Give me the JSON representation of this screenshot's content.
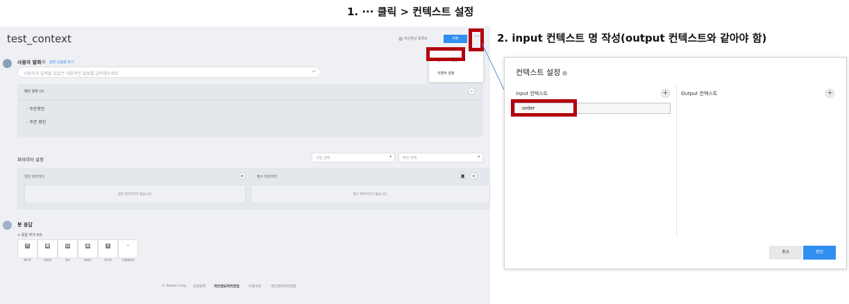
{
  "annotations": {
    "step1": "1. ··· 클릭 > 컨텍스트 설정",
    "step2": "2. input 컨텍스트 명 작성(output 컨텍스트와 같아야 함)"
  },
  "app": {
    "title": "test_context",
    "help_text": "하산하님 합류도",
    "save_label": "저장",
    "more_label": "···",
    "menu": [
      "컨텍스트 설정",
      "이벤트 설정"
    ],
    "user_speech": {
      "label": "사용자 발화",
      "link": "관련 도움말 보기",
      "placeholder": "사용자가 입력할 것같은 대표적인 발화를 입력해주세요",
      "list_title": "패턴 발화 (2)",
      "items": [
        "주문확인",
        "주문 확인"
      ]
    },
    "params": {
      "label": "파라미터 설정",
      "select1": "스킬 선택",
      "select2": "버전 선택",
      "general_title": "일반 파라미터",
      "general_empty": "일반 파라미터가 없습니다.",
      "required_title": "필수 파라미터",
      "required_empty": "필수 파라미터가 없습니다."
    },
    "bot": {
      "label": "봇 응답",
      "add_label": "+ 응답 추가 0/3",
      "tiles": [
        {
          "icon": "A",
          "label": "텍스트"
        },
        {
          "icon": "▣",
          "label": "이미지"
        },
        {
          "icon": "▤",
          "label": "카드"
        },
        {
          "icon": "▦",
          "label": "커머스"
        },
        {
          "icon": "≡",
          "label": "리스트"
        },
        {
          "icon": "‹›",
          "label": "스킬데이터"
        }
      ]
    },
    "footer": [
      "© Kakao Corp.",
      "운영정책",
      "개인정보처리방침",
      "이용약관",
      "개인정보처리방침"
    ]
  },
  "dialog": {
    "title": "컨텍스트 설정",
    "input_label": "Input 컨텍스트",
    "output_label": "Output 컨텍스트",
    "input_value": "order",
    "cancel_label": "취소",
    "ok_label": "확인"
  }
}
